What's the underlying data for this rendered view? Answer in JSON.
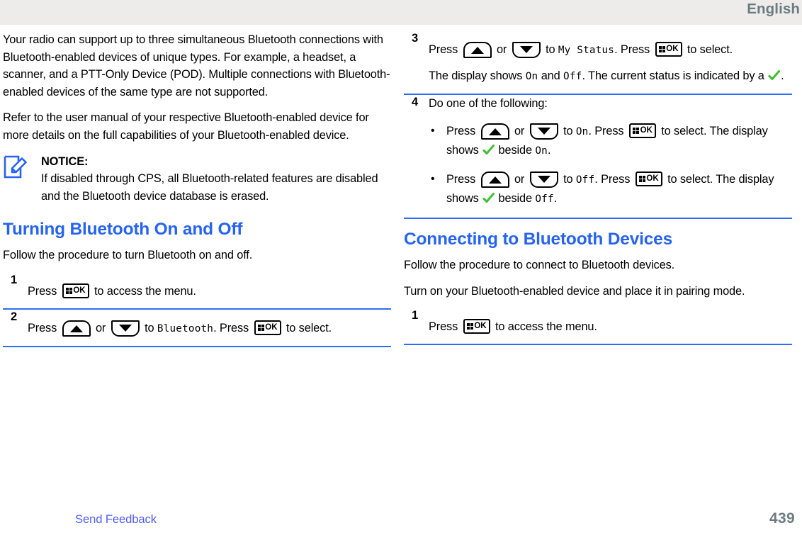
{
  "header": {
    "language": "English"
  },
  "left_column": {
    "paragraphs": [
      "Your radio can support up to three simultaneous Bluetooth connections with Bluetooth-enabled devices of unique types. For example, a headset, a scanner, and a PTT-Only Device (POD). Multiple connections with Bluetooth-enabled devices of the same type are not supported.",
      "Refer to the user manual of your respective Bluetooth-enabled device for more details on the full capabilities of your Bluetooth-enabled device."
    ],
    "notice": {
      "icon": "notice-pencil-icon",
      "title": "NOTICE:",
      "text": "If disabled through CPS, all Bluetooth-related features are disabled and the Bluetooth device database is erased."
    },
    "section": {
      "heading": "Turning Bluetooth On and Off",
      "intro": "Follow the procedure to turn Bluetooth on and off."
    },
    "steps": [
      {
        "number": "1",
        "text_before_key": "Press",
        "key": "ok-key",
        "text_after_key": "to access the menu."
      },
      {
        "number": "2",
        "press_label": "Press",
        "or_label": "or",
        "to_label": "to",
        "menu_item": "Bluetooth",
        "press2_label": ". Press",
        "select_label": "to select."
      }
    ]
  },
  "right_column": {
    "steps": [
      {
        "number": "3",
        "press_label": "Press",
        "or_label": "or",
        "to_label": "to",
        "menu_item": "My Status",
        "press2_label": ". Press",
        "select_label": "to select.",
        "note_prefix": "The display shows",
        "note_on": "On",
        "note_and": "and",
        "note_off": "Off",
        "note_suffix": ". The current status is indicated by a",
        "note_end": "."
      },
      {
        "number": "4",
        "intro": "Do one of the following:",
        "bullets": [
          {
            "press_label": "Press",
            "or_label": "or",
            "to_label": "to",
            "target": "On",
            "press2_label": ". Press",
            "select_label": "to select. The display shows",
            "beside_label": "beside",
            "beside_target": "On",
            "end": "."
          },
          {
            "press_label": "Press",
            "or_label": "or",
            "to_label": "to",
            "target": "Off",
            "press2_label": ". Press",
            "select_label": "to select. The display shows",
            "beside_label": "beside",
            "beside_target": "Off",
            "end": "."
          }
        ]
      }
    ],
    "section": {
      "heading": "Connecting to Bluetooth Devices",
      "intro": "Follow the procedure to connect to Bluetooth devices.",
      "intro2": "Turn on your Bluetooth-enabled device and place it in pairing mode."
    },
    "steps2": [
      {
        "number": "1",
        "text_before_key": "Press",
        "key": "ok-key",
        "text_after_key": "to access the menu."
      }
    ]
  },
  "footer": {
    "send_feedback": "Send Feedback",
    "page_number": "439"
  },
  "colors": {
    "heading_blue": "#2563f0",
    "rule_blue": "#2e6ef5",
    "link_blue": "#4f5ef2",
    "header_gray": "#edecea",
    "header_text": "#6c7b80",
    "check_green": "#3fc134"
  }
}
